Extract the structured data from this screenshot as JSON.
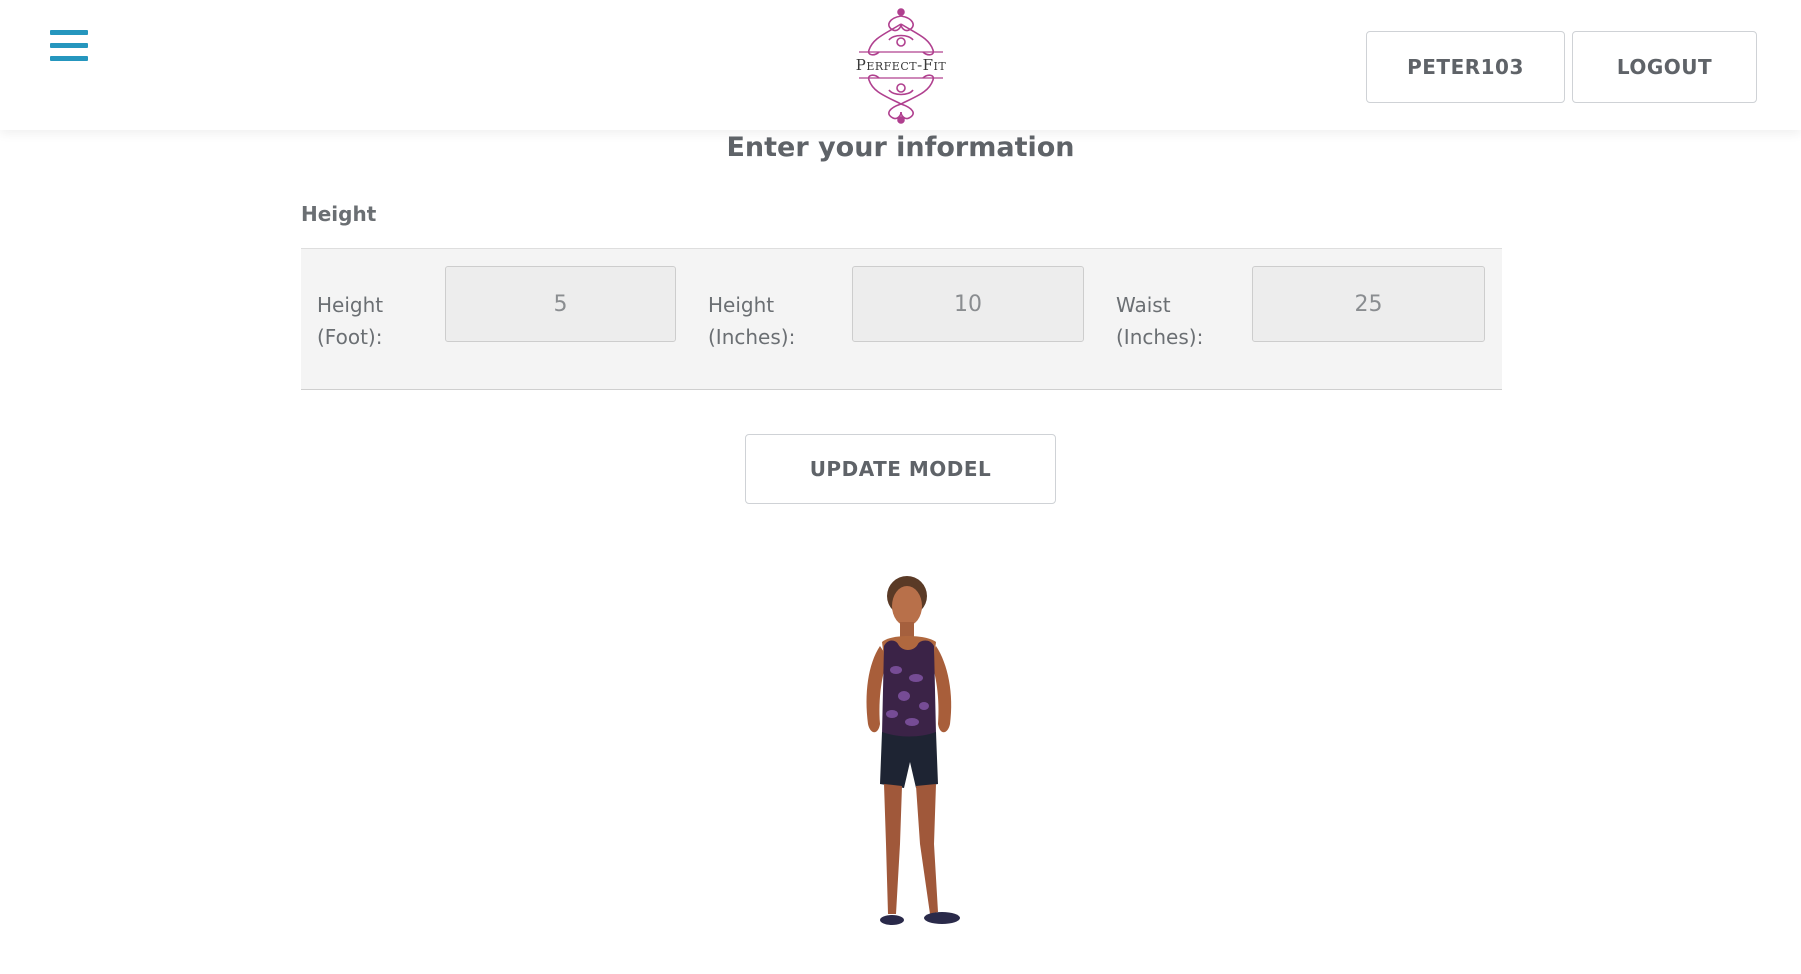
{
  "header": {
    "menu_icon": "hamburger-menu-icon",
    "logo_text": "Perfect-Fit",
    "user_label": "PETER103",
    "logout_label": "LOGOUT",
    "accent_color": "#2596be",
    "logo_color": "#b0408f"
  },
  "main": {
    "title": "Enter your information",
    "section_label": "Height",
    "fields": [
      {
        "label_line1": "Height",
        "label_line2": "(Foot):",
        "value": "5"
      },
      {
        "label_line1": "Height",
        "label_line2": "(Inches):",
        "value": "10"
      },
      {
        "label_line1": "Waist",
        "label_line2": "(Inches):",
        "value": "25"
      }
    ],
    "update_label": "UPDATE MODEL"
  }
}
